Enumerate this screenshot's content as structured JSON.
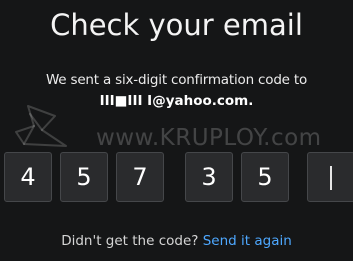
{
  "title": "Check your email",
  "message": "We sent a six-digit confirmation code to",
  "email": "III■III I@yahoo.com.",
  "code_digits": [
    "4",
    "5",
    "7",
    "3",
    "5",
    ""
  ],
  "watermark": "www.KRUPLOY.com",
  "footer": {
    "text": "Didn't get the code?",
    "link": "Send it again"
  },
  "colors": {
    "background": "#151617",
    "box_background": "#2a2b2d",
    "box_border": "#45474a",
    "link": "#4ea8ff"
  }
}
